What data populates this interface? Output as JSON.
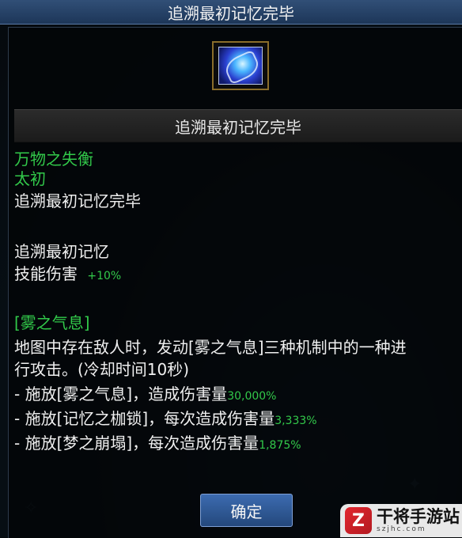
{
  "window": {
    "title": "追溯最初记忆完毕"
  },
  "item": {
    "icon": "swirl-skill-icon",
    "name": "追溯最初记忆完毕"
  },
  "details": {
    "line1": "万物之失衡",
    "line2": "太初",
    "line3": "追溯最初记忆完毕",
    "buff_title": "追溯最初记忆",
    "stat_label": "技能伤害",
    "stat_value": "+10%",
    "skill_name": "[雾之气息]",
    "desc1": "地图中存在敌人时，发动[雾之气息]三种机制中的一种进",
    "desc2": "行攻击。(冷却时间10秒)",
    "b1_text": "- 施放[雾之气息]，造成伤害量",
    "b1_val": "30,000%",
    "b2_text": "- 施放[记忆之枷锁]，每次造成伤害量",
    "b2_val": "3,333%",
    "b3_text": "- 施放[梦之崩塌]，每次造成伤害量",
    "b3_val": "1,875%"
  },
  "buttons": {
    "confirm": "确定"
  },
  "watermark": {
    "logo_char": "Z",
    "title": "干将手游站",
    "url": "szjhc.com"
  },
  "colors": {
    "green_text": "#32c94a",
    "white_text": "#f0f0f0",
    "title_bar": "#1d3658",
    "button": "#2f5a97"
  }
}
